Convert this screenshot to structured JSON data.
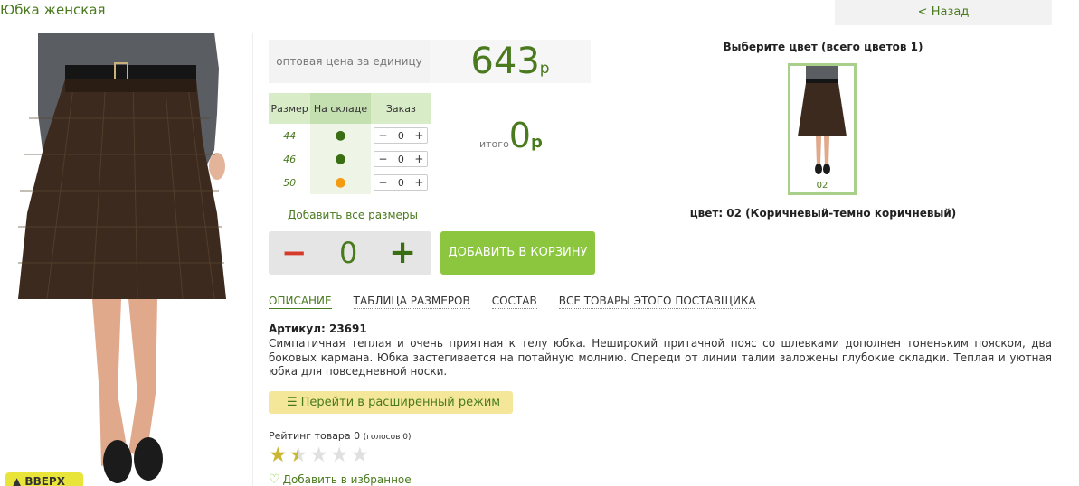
{
  "header": {
    "title": "Юбка женская",
    "back_label": "< Назад"
  },
  "price": {
    "label": "оптовая цена за единицу",
    "value": "643",
    "currency": "р"
  },
  "sizes_table": {
    "headers": [
      "Размер",
      "На складе",
      "Заказ"
    ],
    "rows": [
      {
        "size": "44",
        "stock": "●",
        "qty": "0"
      },
      {
        "size": "46",
        "stock": "●",
        "qty": "0"
      },
      {
        "size": "50",
        "stock": "●",
        "qty": "0"
      }
    ],
    "minus": "−",
    "plus": "+"
  },
  "total": {
    "label": "итого",
    "value": "0",
    "currency": "р"
  },
  "add_all_sizes": "Добавить все размеры",
  "quantity": {
    "minus": "−",
    "value": "0",
    "plus": "+"
  },
  "add_to_cart": "ДОБАВИТЬ В КОРЗИНУ",
  "color": {
    "title": "Выберите цвет (всего цветов 1)",
    "thumb_label": "02",
    "name": "цвет: 02 (Коричневый-темно коричневый)"
  },
  "tabs": [
    "ОПИСАНИЕ",
    "ТАБЛИЦА РАЗМЕРОВ",
    "СОСТАВ",
    "ВСЕ ТОВАРЫ ЭТОГО ПОСТАВЩИКА"
  ],
  "article": "Артикул: 23691",
  "description": "Симпатичная теплая и очень приятная к телу юбка. Неширокий притачной пояс со шлевками дополнен тоненьким пояском, два боковых кармана. Юбка застегивается на потайную молнию. Спереди от линии талии заложены глубокие складки. Теплая и уютная юбка для повседневной носки.",
  "advanced_mode": "Перейти в расширенный режим",
  "rating": {
    "label": "Рейтинг товара 0",
    "votes": "(голосов 0)",
    "stars_filled": 1.5,
    "stars_total": 5
  },
  "favorites": "Добавить в избранное",
  "to_top": "ВВЕРХ",
  "colors": {
    "accent": "#4a7a1e",
    "button_green": "#8cc63f",
    "minus_red": "#d63a2a",
    "stock_orange": "#f39c12"
  }
}
